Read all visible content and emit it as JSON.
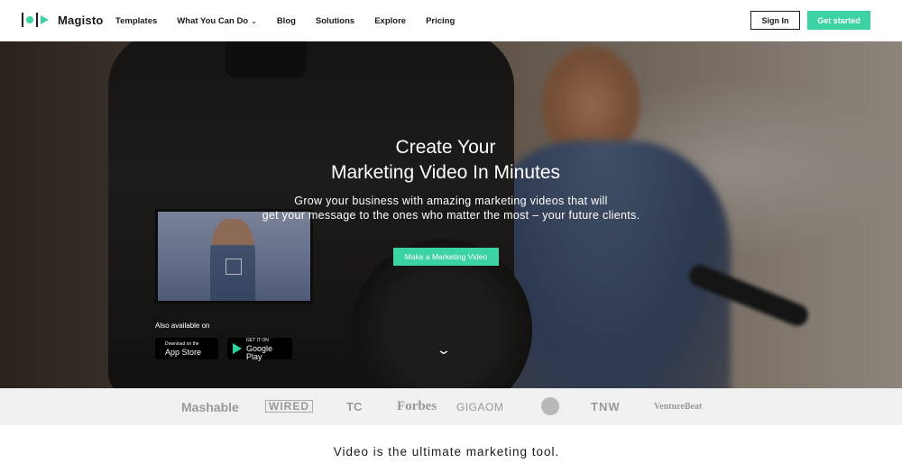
{
  "brand": {
    "name": "Magisto",
    "accent": "#3bd3a3"
  },
  "nav": {
    "items": [
      {
        "label": "Templates"
      },
      {
        "label": "What You Can Do",
        "has_dropdown": true
      },
      {
        "label": "Blog"
      },
      {
        "label": "Solutions"
      },
      {
        "label": "Explore"
      },
      {
        "label": "Pricing"
      }
    ],
    "sign_in": "Sign In",
    "get_started": "Get started"
  },
  "hero": {
    "title_line1": "Create Your",
    "title_line2": "Marketing Video In Minutes",
    "subtitle_line1": "Grow your business with amazing marketing videos that will",
    "subtitle_line2": "get your message to the ones who matter the most – your future clients.",
    "cta": "Make a Marketing Video",
    "also_available": "Also available on",
    "app_store": {
      "small": "Download on the",
      "big": "App Store",
      "icon": "apple-icon"
    },
    "google_play": {
      "small": "GET IT ON",
      "big": "Google Play",
      "icon": "google-play-icon"
    }
  },
  "press_logos": [
    {
      "name": "Mashable"
    },
    {
      "name": "WIRED"
    },
    {
      "name": "TC"
    },
    {
      "name": "Forbes"
    },
    {
      "name": "GIGAOM"
    },
    {
      "name": "TNW"
    },
    {
      "name": "VentureBeat"
    }
  ],
  "section": {
    "heading": "Video is the ultimate marketing tool."
  }
}
